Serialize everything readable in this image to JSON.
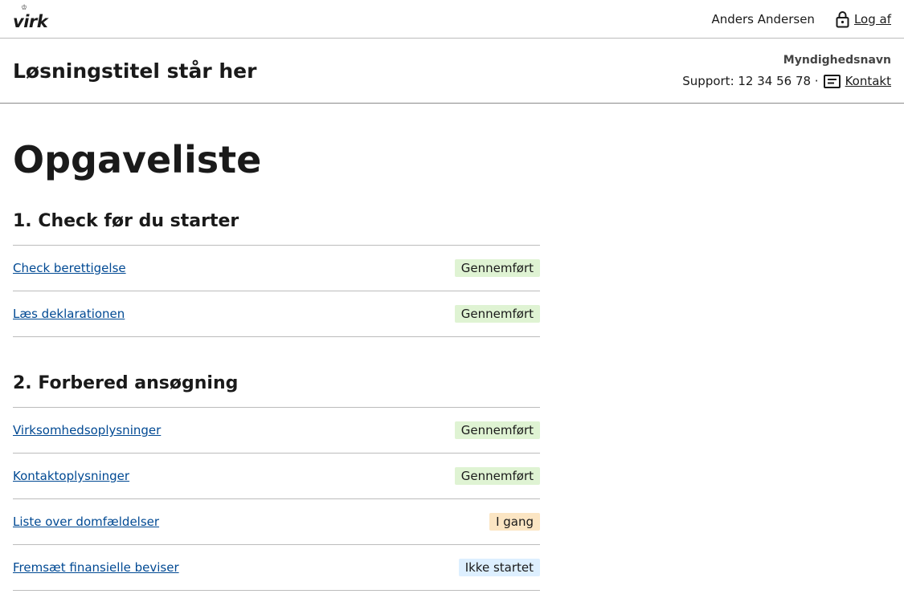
{
  "portal": {
    "logo_text": "virk",
    "user_name": "Anders Andersen",
    "logout_label": "Log af"
  },
  "solution": {
    "title": "Løsningstitel står her",
    "authority": "Myndighedsnavn",
    "support_text": "Support: 12 34 56 78 ·",
    "contact_label": "Kontakt"
  },
  "page": {
    "title": "Opgaveliste"
  },
  "sections": [
    {
      "heading": "1. Check før du starter",
      "tasks": [
        {
          "label": "Check berettigelse",
          "status": "Gennemført"
        },
        {
          "label": "Læs deklarationen",
          "status": "Gennemført"
        }
      ]
    },
    {
      "heading": "2. Forbered ansøgning",
      "tasks": [
        {
          "label": "Virksomhedsoplysninger",
          "status": "Gennemført"
        },
        {
          "label": "Kontaktoplysninger",
          "status": "Gennemført"
        },
        {
          "label": "Liste over domfældelser",
          "status": "I gang"
        },
        {
          "label": "Fremsæt finansielle beviser",
          "status": "Ikke startet"
        }
      ]
    }
  ],
  "colors": {
    "link": "#004993",
    "status_done_bg": "#dff3d3",
    "status_in_progress_bg": "#fbe5c3",
    "status_not_started_bg": "#ddefff"
  },
  "icons": {
    "logo_crown": "crown-icon",
    "logout": "lock-icon",
    "contact": "message-icon"
  }
}
